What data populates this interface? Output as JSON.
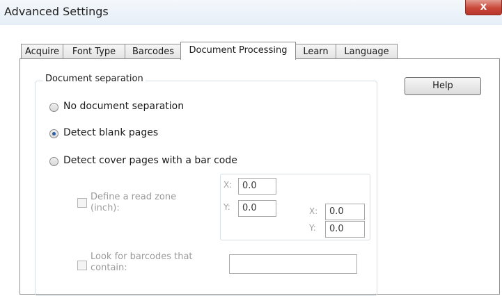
{
  "window": {
    "title": "Advanced Settings",
    "close_label": "x"
  },
  "tabs": [
    {
      "label": "Acquire",
      "active": false
    },
    {
      "label": "Font Type",
      "active": false
    },
    {
      "label": "Barcodes",
      "active": false
    },
    {
      "label": "Document Processing",
      "active": true
    },
    {
      "label": "Learn",
      "active": false
    },
    {
      "label": "Language",
      "active": false
    }
  ],
  "document_separation": {
    "group_label": "Document separation",
    "options": [
      {
        "label": "No document separation",
        "checked": false
      },
      {
        "label": "Detect blank pages",
        "checked": true
      },
      {
        "label": "Detect cover pages with a bar code",
        "checked": false
      }
    ]
  },
  "read_zone": {
    "checkbox_label_line1": "Define a read zone",
    "checkbox_label_line2": "(inch):",
    "x_label": "X:",
    "y_label": "Y:",
    "x1": "0.0",
    "y1": "0.0",
    "x2": "0.0",
    "y2": "0.0"
  },
  "barcode_filter": {
    "checkbox_label_line1": "Look for barcodes that",
    "checkbox_label_line2": "contain:",
    "value": ""
  },
  "buttons": {
    "help": "Help"
  }
}
